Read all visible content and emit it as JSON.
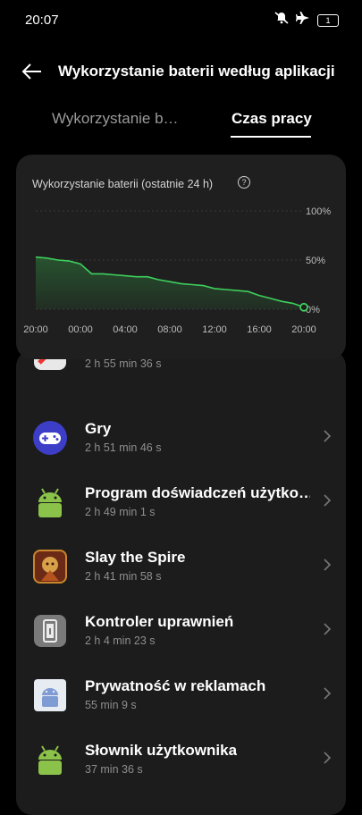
{
  "status": {
    "time": "20:07",
    "battery": "1"
  },
  "header": {
    "title": "Wykorzystanie baterii według aplikacji"
  },
  "tabs": [
    {
      "label": "Wykorzystanie b…",
      "active": false
    },
    {
      "label": "Czas pracy",
      "active": true
    }
  ],
  "chart_card": {
    "title": "Wykorzystanie baterii (ostatnie 24 h)"
  },
  "chart_data": {
    "type": "area",
    "title": "Wykorzystanie baterii (ostatnie 24 h)",
    "x_ticks": [
      "20:00",
      "00:00",
      "04:00",
      "08:00",
      "12:00",
      "16:00",
      "20:00"
    ],
    "y_ticks": [
      "100%",
      "50%",
      "0%"
    ],
    "ylim": [
      0,
      100
    ],
    "x_hours": [
      0,
      1,
      2,
      3,
      4,
      5,
      6,
      7,
      8,
      9,
      10,
      11,
      12,
      13,
      14,
      15,
      16,
      17,
      18,
      19,
      20,
      21,
      22,
      23,
      24
    ],
    "values": [
      53,
      52,
      50,
      49,
      46,
      36,
      36,
      35,
      34,
      33,
      33,
      30,
      28,
      26,
      25,
      24,
      21,
      20,
      19,
      18,
      14,
      11,
      8,
      6,
      2
    ],
    "color": "#3ecf5c",
    "grid": true
  },
  "apps": [
    {
      "name": "",
      "time": "2 h 55 min 36 s",
      "icon": "app-partial-icon"
    },
    {
      "name": "Gry",
      "time": "2 h 51 min 46 s",
      "icon": "gamepad-icon"
    },
    {
      "name": "Program doświadczeń użytko…",
      "time": "2 h 49 min 1 s",
      "icon": "android-icon"
    },
    {
      "name": "Slay the Spire",
      "time": "2 h 41 min 58 s",
      "icon": "slay-the-spire-icon"
    },
    {
      "name": "Kontroler uprawnień",
      "time": "2 h 4 min 23 s",
      "icon": "permission-controller-icon"
    },
    {
      "name": "Prywatność w reklamach",
      "time": "55 min 9 s",
      "icon": "ad-privacy-icon"
    },
    {
      "name": "Słownik użytkownika",
      "time": "37 min 36 s",
      "icon": "android-icon"
    }
  ]
}
